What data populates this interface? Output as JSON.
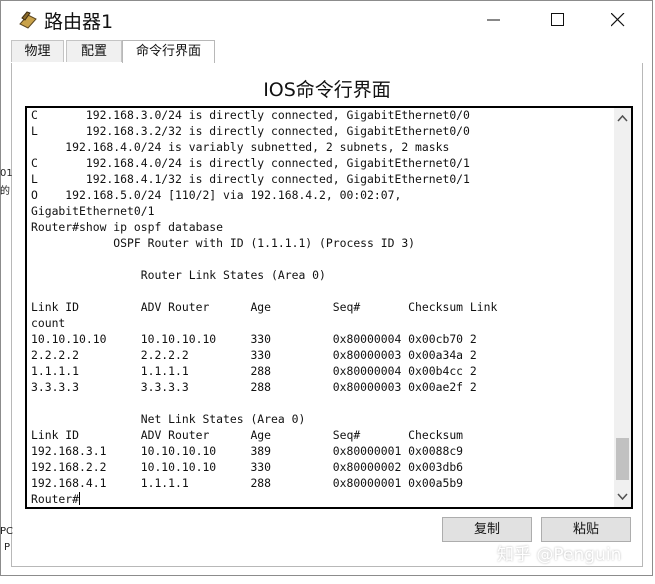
{
  "window": {
    "title": "路由器1",
    "tabs": [
      {
        "label": "物理",
        "active": false
      },
      {
        "label": "配置",
        "active": false
      },
      {
        "label": "命令行界面",
        "active": true
      }
    ]
  },
  "cli": {
    "heading": "IOS命令行界面",
    "lines": [
      "C       192.168.3.0/24 is directly connected, GigabitEthernet0/0",
      "L       192.168.3.2/32 is directly connected, GigabitEthernet0/0",
      "     192.168.4.0/24 is variably subnetted, 2 subnets, 2 masks",
      "C       192.168.4.0/24 is directly connected, GigabitEthernet0/1",
      "L       192.168.4.1/32 is directly connected, GigabitEthernet0/1",
      "O    192.168.5.0/24 [110/2] via 192.168.4.2, 00:02:07,",
      "GigabitEthernet0/1",
      "Router#show ip ospf database",
      "            OSPF Router with ID (1.1.1.1) (Process ID 3)",
      "",
      "                Router Link States (Area 0)",
      "",
      "Link ID         ADV Router      Age         Seq#       Checksum Link",
      "count",
      "10.10.10.10     10.10.10.10     330         0x80000004 0x00cb70 2",
      "2.2.2.2         2.2.2.2         330         0x80000003 0x00a34a 2",
      "1.1.1.1         1.1.1.1         288         0x80000004 0x00b4cc 2",
      "3.3.3.3         3.3.3.3         288         0x80000003 0x00ae2f 2",
      "",
      "                Net Link States (Area 0)",
      "Link ID         ADV Router      Age         Seq#       Checksum",
      "192.168.3.1     10.10.10.10     389         0x80000001 0x0088c9",
      "192.168.2.2     10.10.10.10     330         0x80000002 0x003db6",
      "192.168.4.1     1.1.1.1         288         0x80000001 0x00a5b9"
    ],
    "prompt": "Router#"
  },
  "buttons": {
    "copy": "复制",
    "paste": "粘贴"
  },
  "watermark": "知乎 @Penguin",
  "desktop_fragments": [
    "01",
    "的",
    "PC",
    "P"
  ]
}
